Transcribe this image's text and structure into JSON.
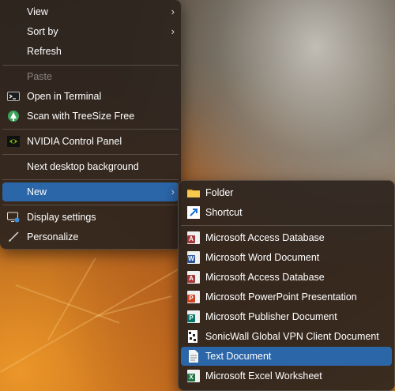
{
  "context_menu": {
    "items": [
      {
        "label": "View",
        "has_submenu": true
      },
      {
        "label": "Sort by",
        "has_submenu": true
      },
      {
        "label": "Refresh"
      },
      {
        "label": "Paste",
        "disabled": true
      },
      {
        "label": "Open in Terminal",
        "icon": "terminal-icon"
      },
      {
        "label": "Scan with TreeSize Free",
        "icon": "treesize-icon"
      },
      {
        "label": "NVIDIA Control Panel",
        "icon": "nvidia-icon"
      },
      {
        "label": "Next desktop background"
      },
      {
        "label": "New",
        "has_submenu": true,
        "highlighted": true
      },
      {
        "label": "Display settings",
        "icon": "display-settings-icon"
      },
      {
        "label": "Personalize",
        "icon": "personalize-brush-icon"
      }
    ]
  },
  "new_submenu": {
    "items": [
      {
        "label": "Folder",
        "icon": "folder-icon"
      },
      {
        "label": "Shortcut",
        "icon": "shortcut-icon"
      },
      {
        "label": "Microsoft Access Database",
        "icon": "access-icon"
      },
      {
        "label": "Microsoft Word Document",
        "icon": "word-icon"
      },
      {
        "label": "Microsoft Access Database",
        "icon": "access-icon"
      },
      {
        "label": "Microsoft PowerPoint Presentation",
        "icon": "powerpoint-icon"
      },
      {
        "label": "Microsoft Publisher Document",
        "icon": "publisher-icon"
      },
      {
        "label": "SonicWall Global VPN Client Document",
        "icon": "sonicwall-icon"
      },
      {
        "label": "Text Document",
        "icon": "text-document-icon",
        "highlighted": true
      },
      {
        "label": "Microsoft Excel Worksheet",
        "icon": "excel-icon"
      }
    ]
  },
  "glyphs": {
    "chevron": "›"
  },
  "colors": {
    "highlight": "#2b66a8",
    "menu_bg": "#2c241e"
  }
}
